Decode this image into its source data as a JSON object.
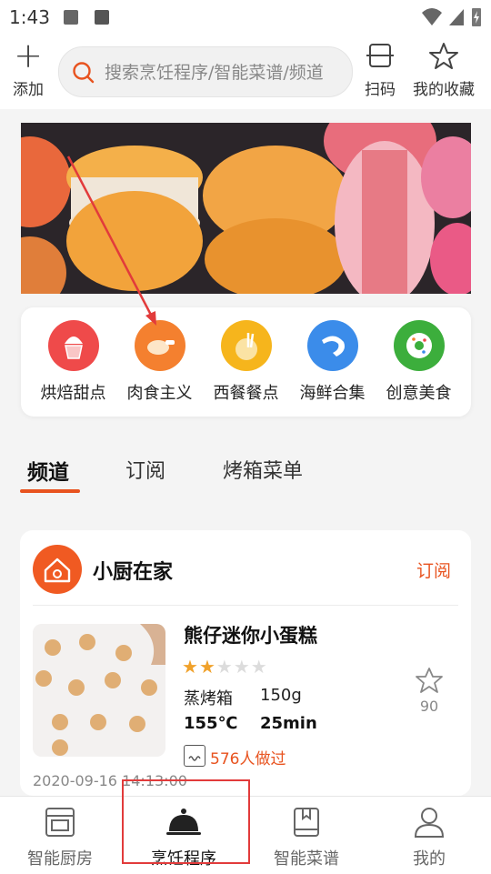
{
  "status_bar": {
    "time": "1:43"
  },
  "header": {
    "add_label": "添加",
    "search_placeholder": "搜索烹饪程序/智能菜谱/频道",
    "scan_label": "扫码",
    "favorites_label": "我的收藏"
  },
  "categories": [
    {
      "label": "烘焙甜点",
      "color": "#ef4a4a",
      "icon": "cupcake-icon"
    },
    {
      "label": "肉食主义",
      "color": "#f4802f",
      "icon": "chicken-leg-icon"
    },
    {
      "label": "西餐餐点",
      "color": "#f6b51c",
      "icon": "western-food-icon"
    },
    {
      "label": "海鲜合集",
      "color": "#3b8cea",
      "icon": "shrimp-icon"
    },
    {
      "label": "创意美食",
      "color": "#3cae3c",
      "icon": "donut-icon"
    }
  ],
  "tabs": [
    {
      "label": "频道",
      "active": true
    },
    {
      "label": "订阅",
      "active": false
    },
    {
      "label": "烤箱菜单",
      "active": false
    }
  ],
  "channel_card": {
    "channel_name": "小厨在家",
    "subscribe_label": "订阅",
    "recipe": {
      "title": "熊仔迷你小蛋糕",
      "rating": 2,
      "rating_max": 5,
      "appliance": "蒸烤箱",
      "weight": "150g",
      "temperature": "155℃",
      "duration": "25min",
      "cooked_count": "576人做过",
      "favorite_count": "90"
    },
    "date": "2020-09-16 14:13:00"
  },
  "bottom_nav": [
    {
      "label": "智能厨房",
      "icon": "oven-icon",
      "active": false
    },
    {
      "label": "烹饪程序",
      "icon": "cloche-icon",
      "active": true
    },
    {
      "label": "智能菜谱",
      "icon": "recipe-book-icon",
      "active": false
    },
    {
      "label": "我的",
      "icon": "user-icon",
      "active": false
    }
  ],
  "colors": {
    "accent": "#e8531f",
    "annotation_red": "#e23b3b",
    "star": "#f0a12a"
  }
}
